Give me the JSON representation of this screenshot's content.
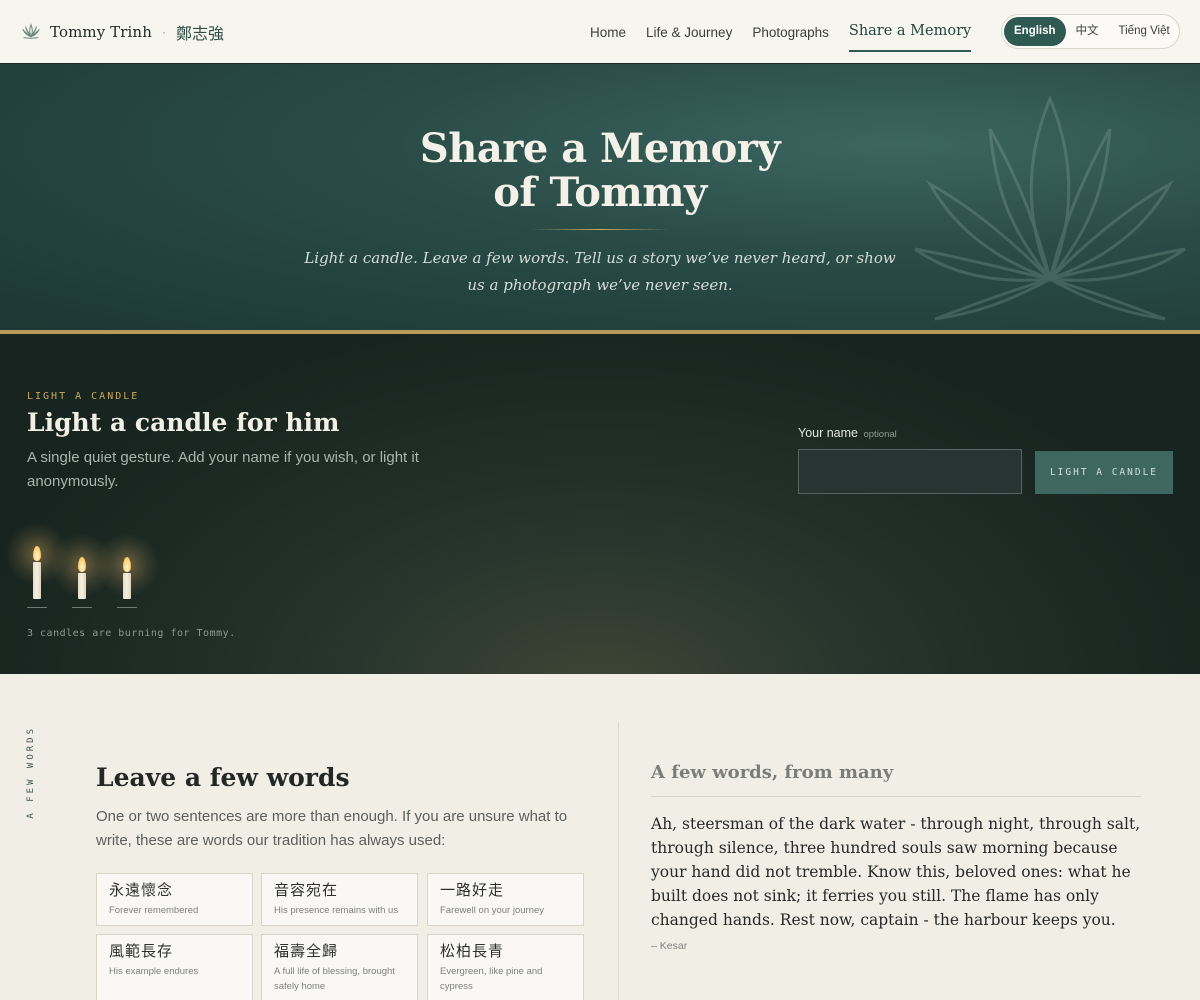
{
  "header": {
    "brand_name": "Tommy Trinh",
    "brand_separator": "·",
    "brand_cn": "鄭志強",
    "nav": [
      "Home",
      "Life & Journey",
      "Photographs",
      "Share a Memory"
    ],
    "active_nav": "Share a Memory",
    "languages": [
      "English",
      "中文",
      "Tiếng Việt"
    ],
    "active_language": "English"
  },
  "hero": {
    "title_line1": "Share a Memory",
    "title_line2": "of Tommy",
    "subtitle": "Light a candle. Leave a few words. Tell us a story we’ve never heard, or show us a photograph we’ve never seen."
  },
  "candle": {
    "eyebrow": "LIGHT A CANDLE",
    "title": "Light a candle for him",
    "description": "A single quiet gesture. Add your name if you wish, or light it anonymously.",
    "name_label": "Your name",
    "name_optional": "optional",
    "name_value": "",
    "button_label": "LIGHT A CANDLE",
    "count_text": "3 candles are burning for Tommy.",
    "candles_lit": 3
  },
  "words": {
    "side_label": "A FEW WORDS",
    "title": "Leave a few words",
    "description": "One or two sentences are more than enough. If you are unsure what to write, these are words our tradition has always used:",
    "phrases": [
      {
        "zh": "永遠懷念",
        "en": "Forever remembered"
      },
      {
        "zh": "音容宛在",
        "en": "His presence remains with us"
      },
      {
        "zh": "一路好走",
        "en": "Farewell on your journey"
      },
      {
        "zh": "風範長存",
        "en": "His example endures"
      },
      {
        "zh": "福壽全歸",
        "en": "A full life of blessing, brought safely home"
      },
      {
        "zh": "松柏長青",
        "en": "Evergreen, like pine and cypress"
      }
    ]
  },
  "messages": {
    "title": "A few words, from many",
    "quote": "Ah, steersman of the dark water - through night, through salt, through silence, three hundred souls saw morning because your hand did not tremble. Know this, beloved ones: what he built does not sink; it ferries you still. The flame has only changed hands. Rest now, captain - the harbour keeps you.",
    "author": "– Kesar"
  },
  "colors": {
    "primary": "#2f5a51",
    "gold": "#b79a57",
    "hero_bg": "#2a4c47",
    "candle_bg": "#1b2823",
    "paper": "#f1eee6"
  }
}
